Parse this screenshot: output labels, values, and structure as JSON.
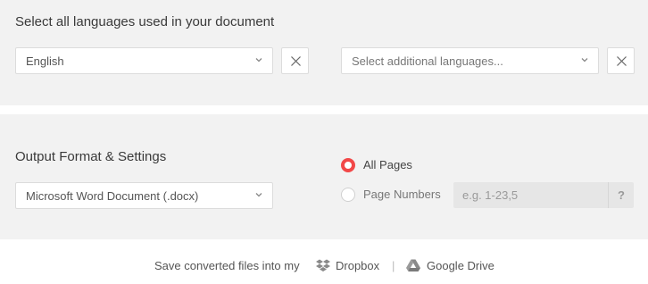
{
  "languages": {
    "heading": "Select all languages used in your document",
    "primary_value": "English",
    "additional_placeholder": "Select additional languages..."
  },
  "output": {
    "heading": "Output Format & Settings",
    "format_value": "Microsoft Word Document (.docx)",
    "radio_all_label": "All Pages",
    "radio_pages_label": "Page Numbers",
    "pages_placeholder": "e.g. 1-23,5",
    "help_label": "?",
    "selected_radio": "all-pages"
  },
  "footer": {
    "text": "Save converted files into my",
    "dropbox_label": "Dropbox",
    "separator": "|",
    "gdrive_label": "Google Drive"
  },
  "colors": {
    "accent": "#f24848",
    "panel_bg": "#f2f2f2"
  },
  "icons": [
    "chevron-down-icon",
    "close-icon",
    "dropbox-icon",
    "google-drive-icon"
  ]
}
